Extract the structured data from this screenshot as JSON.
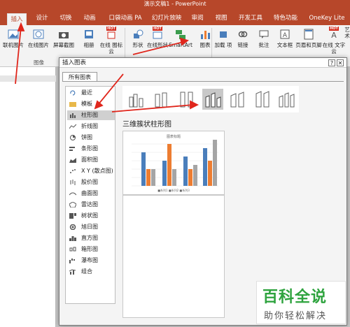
{
  "app": {
    "title": "演示文稿1 - PowerPoint"
  },
  "tabs": [
    {
      "label": "插入",
      "active": true
    },
    {
      "label": "设计"
    },
    {
      "label": "切换"
    },
    {
      "label": "动画"
    },
    {
      "label": "口袋动画 PA"
    },
    {
      "label": "幻灯片放映"
    },
    {
      "label": "审阅"
    },
    {
      "label": "视图"
    },
    {
      "label": "开发工具"
    },
    {
      "label": "特色功能"
    },
    {
      "label": "OneKey Lite"
    }
  ],
  "ribbon": {
    "buttons": [
      {
        "label": "联机图片"
      },
      {
        "label": "在线图片"
      },
      {
        "label": "屏幕截图"
      },
      {
        "label": "相册"
      },
      {
        "label": "在线\n图标云"
      },
      {
        "label": "形状"
      },
      {
        "label": "在线形状"
      },
      {
        "label": "SmartArt"
      },
      {
        "label": "图表"
      },
      {
        "label": "加载\n项"
      },
      {
        "label": "链接"
      },
      {
        "label": "批注"
      },
      {
        "label": "文本框"
      },
      {
        "label": "页眉和页脚"
      },
      {
        "label": "在线\n文字云"
      },
      {
        "label": "艺术"
      }
    ],
    "group_label": "图像",
    "hot_badge": "HOT"
  },
  "dialog": {
    "title": "插入图表",
    "help": "?",
    "close": "✕",
    "tab": "所有图表",
    "categories": [
      {
        "label": "最近",
        "icon": "recent-icon"
      },
      {
        "label": "模板",
        "icon": "folder-icon"
      },
      {
        "label": "柱形图",
        "icon": "column-chart-icon",
        "selected": true
      },
      {
        "label": "折线图",
        "icon": "line-chart-icon"
      },
      {
        "label": "饼图",
        "icon": "pie-chart-icon"
      },
      {
        "label": "条形图",
        "icon": "bar-chart-icon"
      },
      {
        "label": "面积图",
        "icon": "area-chart-icon"
      },
      {
        "label": "X Y (散点图)",
        "icon": "scatter-chart-icon"
      },
      {
        "label": "股价图",
        "icon": "stock-chart-icon"
      },
      {
        "label": "曲面图",
        "icon": "surface-chart-icon"
      },
      {
        "label": "雷达图",
        "icon": "radar-chart-icon"
      },
      {
        "label": "树状图",
        "icon": "treemap-chart-icon"
      },
      {
        "label": "旭日图",
        "icon": "sunburst-chart-icon"
      },
      {
        "label": "直方图",
        "icon": "histogram-chart-icon"
      },
      {
        "label": "箱形图",
        "icon": "boxplot-chart-icon"
      },
      {
        "label": "瀑布图",
        "icon": "waterfall-chart-icon"
      },
      {
        "label": "组合",
        "icon": "combo-chart-icon"
      }
    ],
    "subtype_title": "三维簇状柱形图",
    "preview_title": "图表标题",
    "preview_legend": "■系列1 ■系列2 ■系列3",
    "colors": {
      "series1": "#4a7ebb",
      "series2": "#ed7d31",
      "series3": "#a5a5a5",
      "accent": "#b7472a",
      "arrow": "#e0261c"
    }
  },
  "watermark": {
    "main": "百科全说",
    "sub": "助你轻松解决"
  }
}
